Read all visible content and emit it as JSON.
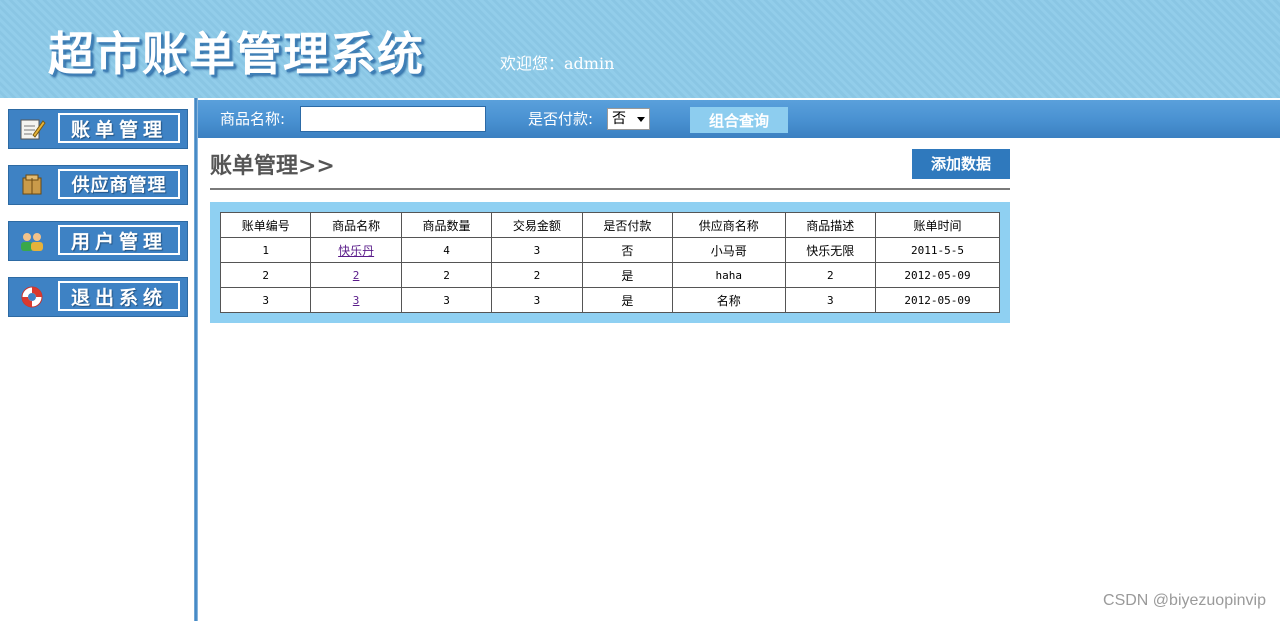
{
  "header": {
    "title": "超市账单管理系统",
    "welcome": "欢迎您：admin"
  },
  "sidebar": {
    "items": [
      {
        "label": "账单管理",
        "icon": "notepad-icon"
      },
      {
        "label": "供应商管理",
        "icon": "box-icon"
      },
      {
        "label": "用户管理",
        "icon": "users-icon"
      },
      {
        "label": "退出系统",
        "icon": "lifebuoy-icon"
      }
    ]
  },
  "toolbar": {
    "name_label": "商品名称:",
    "name_value": "",
    "paid_label": "是否付款:",
    "paid_selected": "否",
    "query_button": "组合查询"
  },
  "content": {
    "title": "账单管理>>",
    "add_button": "添加数据"
  },
  "table": {
    "headers": [
      "账单编号",
      "商品名称",
      "商品数量",
      "交易金额",
      "是否付款",
      "供应商名称",
      "商品描述",
      "账单时间"
    ],
    "rows": [
      [
        "1",
        "快乐丹",
        "4",
        "3",
        "否",
        "小马哥",
        "快乐无限",
        "2011-5-5"
      ],
      [
        "2",
        "2",
        "2",
        "2",
        "是",
        "haha",
        "2",
        "2012-05-09"
      ],
      [
        "3",
        "3",
        "3",
        "3",
        "是",
        "名称",
        "3",
        "2012-05-09"
      ]
    ]
  },
  "watermark": "CSDN @biyezuopinvip",
  "colors": {
    "header_bg": "#92cdea",
    "toolbar_bg": "#4a92d2",
    "button_blue": "#2f79bd",
    "panel_bg": "#8fd0f2"
  }
}
